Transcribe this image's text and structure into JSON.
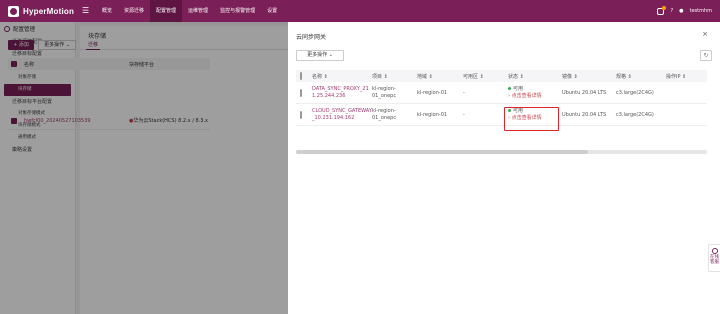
{
  "app": {
    "name": "HyperMotion",
    "menu_icon": "menu-icon"
  },
  "nav": [
    "概览",
    "资源迁移",
    "配置管理",
    "运维管理",
    "监控与报警管理",
    "设置"
  ],
  "nav_active_index": 2,
  "user": {
    "name": "testmhm",
    "notification_icon": "bell-icon",
    "user_icon": "user-icon"
  },
  "sidebar": {
    "header": "配置管理",
    "items": [
      {
        "label": "迁移源端配置",
        "level": 1
      },
      {
        "label": "迁移目标配置",
        "level": 1
      },
      {
        "label": "存储配置",
        "level": 1
      },
      {
        "label": "对象存储",
        "level": 2
      },
      {
        "label": "块存储",
        "level": 2,
        "active": true
      },
      {
        "label": "迁移目标平台配置",
        "level": 1
      },
      {
        "label": "对象存储模式",
        "level": 2
      },
      {
        "label": "块存储模式",
        "level": 2
      },
      {
        "label": "通用模式",
        "level": 2
      },
      {
        "label": "策略设置",
        "level": 1
      }
    ]
  },
  "content": {
    "title": "块存储",
    "tab": "迁移",
    "add_button": "+ 添加",
    "more_button": "更多操作 ⌄",
    "table_headers": {
      "name": "名称",
      "platform": "块存储平台"
    },
    "row": {
      "name": "hwfcl00_20240527103539",
      "platform": "华为云Stack(HCS) 8.2.x / 8.3.x"
    }
  },
  "panel": {
    "title": "云同步网关",
    "more_button": "更多操作 ⌄",
    "refresh_icon": "refresh-icon",
    "headers": [
      "名称 ⇕",
      "项目 ⇕",
      "地域 ⇕",
      "可用区 ⇕",
      "状态 ⇕",
      "镜像 ⇕",
      "规格 ⇕",
      "操作IP ⇕"
    ],
    "rows": [
      {
        "name": "DATA_SYNC_PROXY_211.25.244.236",
        "project": "kl-region-01_onepc",
        "region": "kl-region-01",
        "az": "-",
        "status": "可用",
        "status_link": "› 点击查看详情",
        "image": "Ubuntu 20.04 LTS",
        "spec": "c3.large(2C4G)",
        "ip": ""
      },
      {
        "name": "CLOUD_SYNC_GATEWAY_10.231.194.162",
        "project": "kl-region-01_onepc",
        "region": "kl-region-01",
        "az": "-",
        "status": "可用",
        "status_link": "› 点击查看详情",
        "image": "Ubuntu 20.04 LTS",
        "spec": "c3.large(2C4G)",
        "ip": ""
      }
    ]
  },
  "float_help": {
    "label": "在线客服",
    "icon": "chat-icon"
  },
  "colors": {
    "brand": "#7a1f57",
    "status_ok": "#3aa856",
    "highlight": "#e0242d"
  }
}
